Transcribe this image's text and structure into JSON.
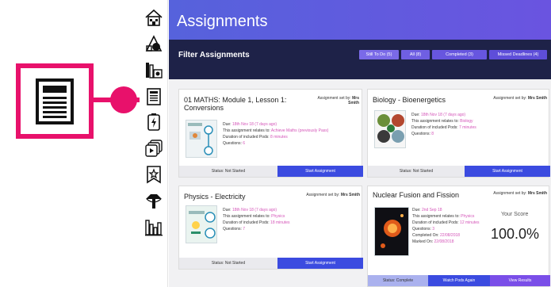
{
  "page": {
    "title": "Assignments"
  },
  "filter": {
    "label": "Filter Assignments",
    "buttons": [
      "Still To Do (5)",
      "All (8)",
      "Completed (3)",
      "Missed Deadlines (4)"
    ]
  },
  "cards": [
    {
      "title": "01 MATHS: Module 1, Lesson 1: Conversions",
      "setby_label": "Assignment set by:",
      "setby_name": "Mrs Smith",
      "due_label": "Due:",
      "due_value": "18th Nov 18 (7 days ago)",
      "relates_label": "This assignment relates to:",
      "relates_value": "Achieve Maths (previously Pass)",
      "duration_label": "Duration of included Pods:",
      "duration_value": "8 minutes",
      "questions_label": "Questions:",
      "questions_value": "6",
      "status": "Status: Not Started",
      "button": "Start Assignment"
    },
    {
      "title": "Biology - Bioenergetics",
      "setby_label": "Assignment set by:",
      "setby_name": "Mrs Smith",
      "due_label": "Due:",
      "due_value": "18th Nov 18 (7 days ago)",
      "relates_label": "This assignment relates to:",
      "relates_value": "Biology",
      "duration_label": "Duration of included Pods:",
      "duration_value": "7 minutes",
      "questions_label": "Questions:",
      "questions_value": "8",
      "status": "Status: Not Started",
      "button": "Start Assignment"
    },
    {
      "title": "Physics - Electricity",
      "setby_label": "Assignment set by:",
      "setby_name": "Mrs Smith",
      "due_label": "Due:",
      "due_value": "18th Nov 18 (7 days ago)",
      "relates_label": "This assignment relates to:",
      "relates_value": "Physics",
      "duration_label": "Duration of included Pods:",
      "duration_value": "18 minutes",
      "questions_label": "Questions:",
      "questions_value": "7",
      "status": "Status: Not Started",
      "button": "Start Assignment"
    },
    {
      "title": "Nuclear Fusion and Fission",
      "setby_label": "Assignment set by:",
      "setby_name": "Mrs Smith",
      "due_label": "Due:",
      "due_value": "2nd Sep 18",
      "relates_label": "This assignment relates to:",
      "relates_value": "Physics",
      "duration_label": "Duration of included Pods:",
      "duration_value": "12 minutes",
      "questions_label": "Questions:",
      "questions_value": "3",
      "completed_label": "Completed On:",
      "completed_value": "22/08/2018",
      "marked_label": "Marked On:",
      "marked_value": "22/08/2018",
      "score_label": "Your Score",
      "score_value": "100.0%",
      "status": "Status: Complete",
      "button": "Watch Pods Again",
      "button2": "View Results"
    }
  ],
  "colors": {
    "accent": "#e8116b",
    "primary": "#3b4be0",
    "banner_dark": "#1e2248",
    "link": "#d454b8"
  },
  "rail_icons": [
    "home-icon",
    "shapes-icon",
    "books-icon",
    "document-icon",
    "battery-icon",
    "layers-icon",
    "star-icon",
    "lightbulb-icon",
    "chart-icon"
  ]
}
